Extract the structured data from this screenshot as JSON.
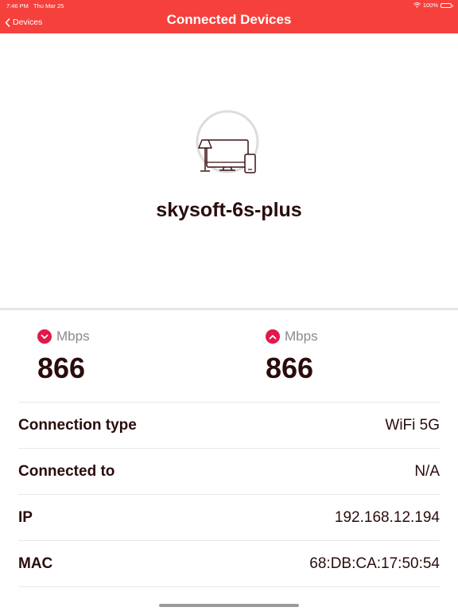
{
  "status_bar": {
    "time": "7:46 PM",
    "date": "Thu Mar 25",
    "battery": "100%"
  },
  "nav": {
    "back_label": "Devices",
    "title": "Connected Devices"
  },
  "device": {
    "name": "skysoft-6s-plus",
    "icon": "devices-icon"
  },
  "speeds": [
    {
      "direction": "download",
      "icon": "chevron-down-icon",
      "unit": "Mbps",
      "value": "866"
    },
    {
      "direction": "upload",
      "icon": "chevron-up-icon",
      "unit": "Mbps",
      "value": "866"
    }
  ],
  "details": [
    {
      "key": "Connection type",
      "value": "WiFi 5G"
    },
    {
      "key": "Connected to",
      "value": "N/A"
    },
    {
      "key": "IP",
      "value": "192.168.12.194"
    },
    {
      "key": "MAC",
      "value": "68:DB:CA:17:50:54"
    }
  ],
  "colors": {
    "header": "#f5403c",
    "accent": "#e3184a",
    "text": "#2a0c0c"
  }
}
